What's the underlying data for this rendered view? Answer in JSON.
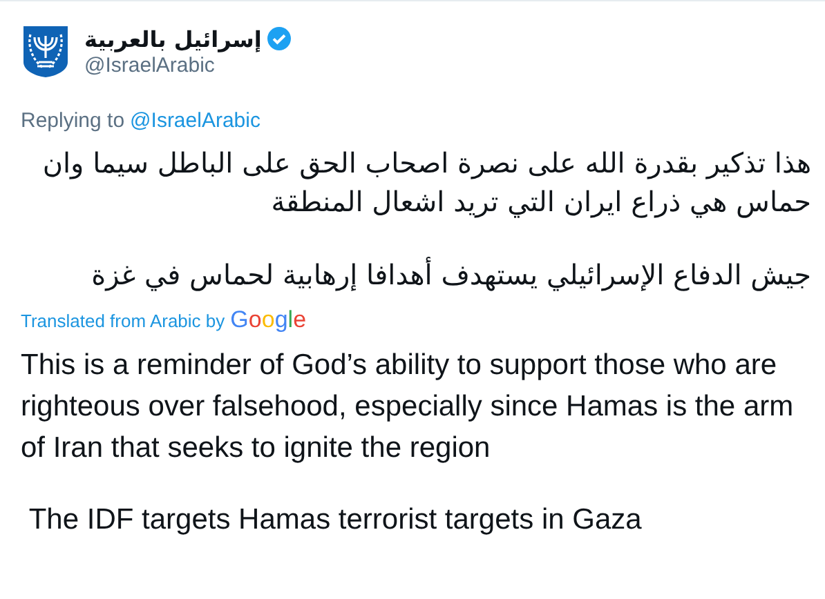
{
  "author": {
    "name": "إسرائيل بالعربية",
    "verified": true,
    "handle": "@IsraelArabic"
  },
  "reply_context": {
    "label": "Replying to",
    "mention": "@IsraelArabic"
  },
  "tweet_paragraphs": [
    "هذا تذكير بقدرة الله على نصرة اصحاب الحق على الباطل سيما وان حماس هي ذراع ايران التي تريد اشعال المنطقة",
    "جيش الدفاع الإسرائيلي يستهدف أهدافا إرهابية لحماس في غزة"
  ],
  "translation": {
    "label": "Translated from Arabic by",
    "provider": "Google",
    "paragraphs": [
      "This is a reminder of God’s ability to support those who are righteous over falsehood, especially since Hamas is the arm of Iran that seeks to ignite the region",
      " The IDF targets Hamas terrorist targets in Gaza"
    ]
  }
}
